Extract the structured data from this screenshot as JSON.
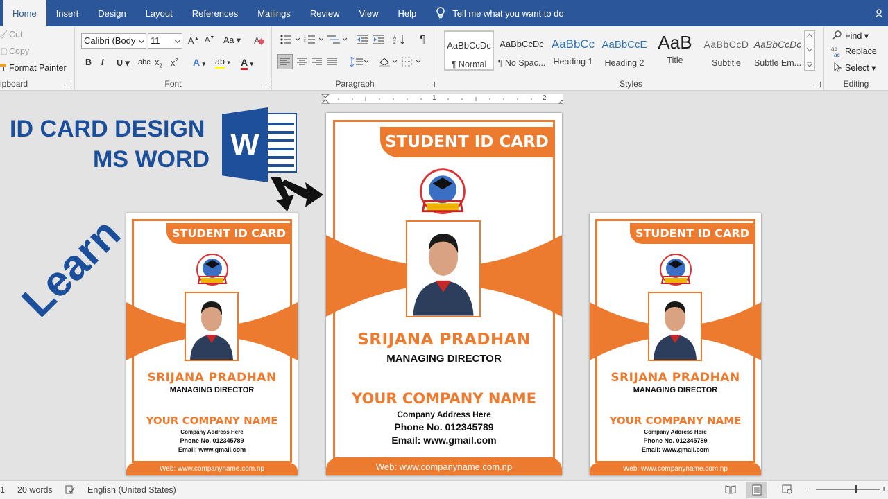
{
  "ribbon": {
    "tabs": [
      {
        "label": "Home",
        "active": true
      },
      {
        "label": "Insert"
      },
      {
        "label": "Design"
      },
      {
        "label": "Layout"
      },
      {
        "label": "References"
      },
      {
        "label": "Mailings"
      },
      {
        "label": "Review"
      },
      {
        "label": "View"
      },
      {
        "label": "Help"
      }
    ],
    "tell_me": "Tell me what you want to do",
    "clipboard": {
      "cut": "Cut",
      "copy": "Copy",
      "format_painter": "Format Painter",
      "group_label": "ipboard"
    },
    "font": {
      "font_name": "Calibri (Body",
      "font_size": "11",
      "change_case": "Aa",
      "group_label": "Font"
    },
    "paragraph": {
      "group_label": "Paragraph"
    },
    "styles": {
      "group_label": "Styles",
      "items": [
        {
          "sample": "AaBbCcDc",
          "name": "¶ Normal"
        },
        {
          "sample": "AaBbCcDc",
          "name": "¶ No Spac..."
        },
        {
          "sample": "AaBbCc",
          "name": "Heading 1"
        },
        {
          "sample": "AaBbCcE",
          "name": "Heading 2"
        },
        {
          "sample": "AaB",
          "name": "Title"
        },
        {
          "sample": "AaBbCcD",
          "name": "Subtitle"
        },
        {
          "sample": "AaBbCcDc",
          "name": "Subtle Em..."
        }
      ]
    },
    "editing": {
      "find": "Find",
      "replace": "Replace",
      "select": "Select",
      "group_label": "Editing"
    }
  },
  "ruler": {
    "marks": [
      "1",
      "2"
    ]
  },
  "promo": {
    "line1": "ID CARD DESIGN",
    "line2": "MS WORD",
    "learn": "Learn",
    "word_logo_letter": "W"
  },
  "cards": [
    {
      "size": "small",
      "header": "STUDENT ID CARD",
      "name": "SRIJANA PRADHAN",
      "role": "MANAGING DIRECTOR",
      "company": "YOUR COMPANY NAME",
      "address": "Company Address Here",
      "phone": "Phone No. 012345789",
      "email": "Email: www.gmail.com",
      "web": "Web: www.companyname.com.np"
    },
    {
      "size": "large",
      "header": "STUDENT ID CARD",
      "name": "SRIJANA PRADHAN",
      "role": "MANAGING DIRECTOR",
      "company": "YOUR COMPANY NAME",
      "address": "Company Address Here",
      "phone": "Phone No. 012345789",
      "email": "Email: www.gmail.com",
      "web": "Web: www.companyname.com.np"
    },
    {
      "size": "small",
      "header": "STUDENT ID CARD",
      "name": "SRIJANA PRADHAN",
      "role": "MANAGING DIRECTOR",
      "company": "YOUR COMPANY NAME",
      "address": "Company Address Here",
      "phone": "Phone No. 012345789",
      "email": "Email: www.gmail.com",
      "web": "Web: www.companyname.com.np"
    }
  ],
  "statusbar": {
    "page": "1",
    "words": "20 words",
    "language": "English (United States)"
  },
  "colors": {
    "ribbon_blue": "#2b579a",
    "accent_orange": "#ec7a2f",
    "promo_blue": "#1b4f9c"
  }
}
